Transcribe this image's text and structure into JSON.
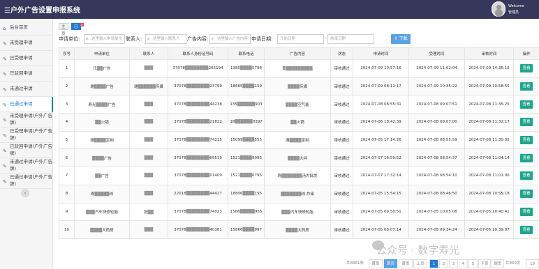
{
  "header": {
    "title": "☰户外广告设置申报系统",
    "welcome": "Welcome",
    "user": "管理员"
  },
  "sidebar": {
    "items": [
      {
        "label": "后台首页",
        "icon": "home-icon"
      },
      {
        "label": "未受理申请",
        "icon": "edit-icon"
      },
      {
        "label": "已受理申请",
        "icon": "edit-icon"
      },
      {
        "label": "已驳回申请",
        "icon": "edit-icon"
      },
      {
        "label": "未通过申请",
        "icon": "edit-icon"
      },
      {
        "label": "已通过申请",
        "icon": "edit-icon"
      },
      {
        "label": "未受理申请(户外广告牌)",
        "icon": "edit-icon"
      },
      {
        "label": "已受理申请(户外广告牌)",
        "icon": "edit-icon"
      },
      {
        "label": "已驳回申请(户外广告牌)",
        "icon": "edit-icon"
      },
      {
        "label": "未通过申请(户外广告牌)",
        "icon": "edit-icon"
      },
      {
        "label": "已通过申请(户外广告牌)",
        "icon": "edit-icon"
      }
    ],
    "collapse": "‹"
  },
  "tabs": [
    {
      "label": "主页"
    },
    {
      "label": "已通过申请"
    }
  ],
  "filter": {
    "unit_label": "申请单位:",
    "unit_ph": "这里输入申请单位",
    "contact_label": "联系人:",
    "contact_ph": "这里输入联系人",
    "content_label": "广告内容:",
    "content_ph": "这里输入广告内容",
    "date_label": "申请日期:",
    "start_ph": "开始日期",
    "dash": "-",
    "end_ph": "结束日期",
    "download": "⇩ 下载"
  },
  "table": {
    "columns": [
      "序号",
      "申请单位",
      "联系人",
      "联系人身份证号码",
      "联系电话",
      "广告内容",
      "状态",
      "申请时间",
      "受理时间",
      "审核时间",
      "操作"
    ],
    "rows": [
      [
        "1",
        "乐▒▒广告",
        "▒▒▒",
        "37078▒▒▒▒▒▒▒▒265194",
        "1385▒▒▒▒5798",
        "黄▒▒▒▒▒▒▒▒▒",
        "审核通过",
        "2024-07-09 10:57:16",
        "2024-07-09 11:02:04",
        "2024-07-09 14:35:15",
        "查看"
      ],
      [
        "2",
        "潍▒▒▒▒广告",
        "潍▒▒▒▒▒▒传媒",
        "37078▒▒▒▒▒▒▒▒23799",
        "18665▒▒▒▒159",
        "▒▒▒▒传媒",
        "审核通过",
        "2024-07-09 08:11:17",
        "2024-07-09 10:35:22",
        "2024-07-09 10:58:55",
        "查看"
      ],
      [
        "3",
        "寿光▒▒▒▒广告",
        "▒▒▒",
        "37078▒▒▒▒▒▒▒▒44238",
        "135▒▒▒▒▒▒903",
        "▒▒▒▒空气能",
        "审核通过",
        "2024-07-08 08:55:31",
        "2024-07-08 09:07:51",
        "2024-07-08 11:35:25",
        "查看"
      ],
      [
        "4",
        "▒▒火锅",
        "▒▒▒",
        "37078▒▒▒▒▒▒▒▒21822",
        "18▒▒▒▒▒▒0397",
        "▒▒火锅",
        "审核通过",
        "2024-07-06 18:42:39",
        "2024-07-08 09:07:00",
        "2024-07-08 11:32:17",
        "查看"
      ],
      [
        "5",
        "潍▒▒▒▒定制",
        "▒▒▒",
        "37078▒▒▒▒▒▒▒▒74215",
        "15099▒▒▒▒555",
        "潍▒▒▒▒定制",
        "审核通过",
        "2024-07-05 17:14:26",
        "2024-07-08 08:55:59",
        "2024-07-08 11:30:05",
        "查看"
      ],
      [
        "6",
        "▒▒▒▒广告",
        "▒▒▒",
        "37078▒▒▒▒▒▒▒▒69519",
        "1521▒▒▒▒9095",
        "▒▒▒▒大拌",
        "审核通过",
        "2024-07-07 16:59:52",
        "2024-07-08 08:54:37",
        "2024-07-08 11:04:14",
        "查看"
      ],
      [
        "7",
        "▒▒广告",
        "▒▒▒",
        "37078▒▒▒▒▒▒▒▒01409",
        "1521▒▒▒▒6795",
        "寿▒▒▒▒▒▒▒汤大批发",
        "审核通过",
        "2024-07-07 17:32:14",
        "2024-07-08 08:54:10",
        "2024-07-08 11:01:06",
        "查看"
      ],
      [
        "8",
        "寿▒▒▒▒▒线",
        "▒▒▒",
        "22018▒▒▒▒▒▒▒▒44427",
        "18806▒▒▒▒155",
        "▒▒▒▒▒▒▒线 炸串",
        "审核通过",
        "2024-07-05 15:54:15",
        "2024-07-08 08:46:50",
        "2024-07-08 10:55:18",
        "查看"
      ],
      [
        "9",
        "▒▒▒汽车快修轮胎",
        "张▒▒",
        "37078▒▒▒▒▒▒▒▒74023",
        "1586▒▒▒▒▒955",
        "▒▒▒汽车快修轮胎",
        "审核通过",
        "2024-07-05 09:50:51",
        "2024-07-05 10:05:08",
        "2024-07-05 10:40:41",
        "查看"
      ],
      [
        "10",
        "▒▒▒▒大药房",
        "▒▒▒",
        "37078▒▒▒▒▒▒▒▒40381",
        "15866▒▒▒▒997",
        "▒▒▒▒大药房",
        "审核通过",
        "2024-07-05 08:07:14",
        "2024-07-05 09:34:24",
        "2024-07-05 10:39:07",
        "查看"
      ]
    ]
  },
  "pager": {
    "total": "共8681条",
    "first_disabled": "首页",
    "prev_page": "首页",
    "first": "首页",
    "prev": "上页",
    "pages": [
      "1",
      "2",
      "3",
      "4",
      "5"
    ],
    "next": "下页",
    "last": "尾页",
    "total_pages": "共869页",
    "size": "10"
  },
  "watermark": "公众号 · 数字寿光"
}
